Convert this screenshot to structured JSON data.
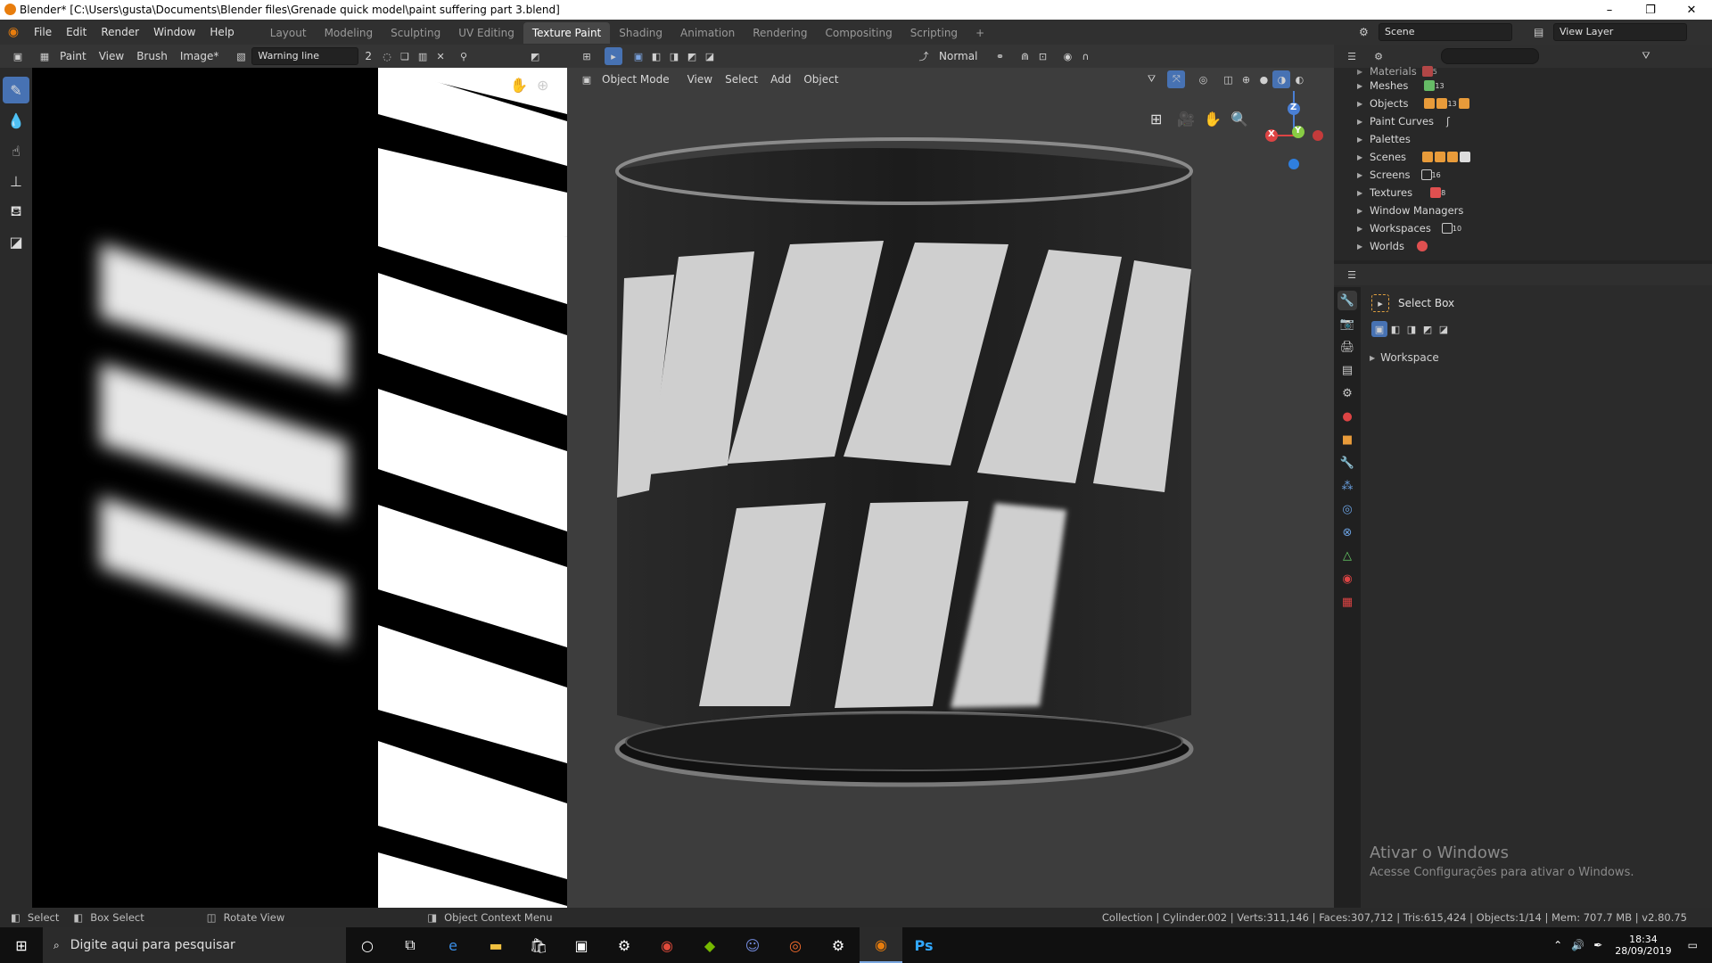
{
  "window": {
    "title": "Blender* [C:\\Users\\gusta\\Documents\\Blender files\\Grenade quick model\\paint suffering part 3.blend]",
    "controls": [
      "–",
      "❐",
      "✕"
    ]
  },
  "topbar": {
    "menus": [
      "File",
      "Edit",
      "Render",
      "Window",
      "Help"
    ],
    "workspaces": [
      "Layout",
      "Modeling",
      "Sculpting",
      "UV Editing",
      "Texture Paint",
      "Shading",
      "Animation",
      "Rendering",
      "Compositing",
      "Scripting"
    ],
    "active_workspace": "Texture Paint",
    "add_tab": "+",
    "scene_label": "Scene",
    "view_layer_label": "View Layer"
  },
  "image_editor": {
    "mode": "Paint",
    "menus": [
      "View",
      "Brush",
      "Image*"
    ],
    "image_name": "Warning line",
    "users": "2"
  },
  "viewport": {
    "shading_mode": "Normal",
    "object_mode": "Object Mode",
    "menus": [
      "View",
      "Select",
      "Add",
      "Object"
    ],
    "gizmo": {
      "x": "X",
      "y": "Y",
      "z": "Z"
    }
  },
  "outliner": {
    "search_placeholder": "",
    "rows": [
      {
        "label": "Materials",
        "badge": "5",
        "color": "#e05050"
      },
      {
        "label": "Meshes",
        "badge": "13",
        "color": "#66bb66"
      },
      {
        "label": "Objects",
        "badge": "13",
        "color": "#e89b3a"
      },
      {
        "label": "Paint Curves",
        "badge": "",
        "color": "#cccccc"
      },
      {
        "label": "Palettes",
        "badge": "",
        "color": ""
      },
      {
        "label": "Scenes",
        "badge": "",
        "color": "#e89b3a"
      },
      {
        "label": "Screens",
        "badge": "16",
        "color": "#cccccc"
      },
      {
        "label": "Textures",
        "badge": "8",
        "color": "#e05050"
      },
      {
        "label": "Window Managers",
        "badge": "",
        "color": ""
      },
      {
        "label": "Workspaces",
        "badge": "10",
        "color": "#cccccc"
      },
      {
        "label": "Worlds",
        "badge": "",
        "color": "#e05050"
      }
    ]
  },
  "properties": {
    "tool_name": "Select Box",
    "section": "Workspace"
  },
  "activation": {
    "title": "Ativar o Windows",
    "subtitle": "Acesse Configurações para ativar o Windows."
  },
  "statusbar": {
    "select": "Select",
    "box_select": "Box Select",
    "rotate_view": "Rotate View",
    "context_menu": "Object Context Menu",
    "stats": "Collection | Cylinder.002 | Verts:311,146 | Faces:307,712 | Tris:615,424 | Objects:1/14 | Mem: 707.7 MB | v2.80.75"
  },
  "taskbar": {
    "search_placeholder": "Digite aqui para pesquisar",
    "time": "18:34",
    "date": "28/09/2019"
  },
  "colors": {
    "accent": "#4772b3",
    "active_tab_bg": "#474747",
    "header_bg": "#353535",
    "viewport_bg": "#3d3d3d"
  }
}
